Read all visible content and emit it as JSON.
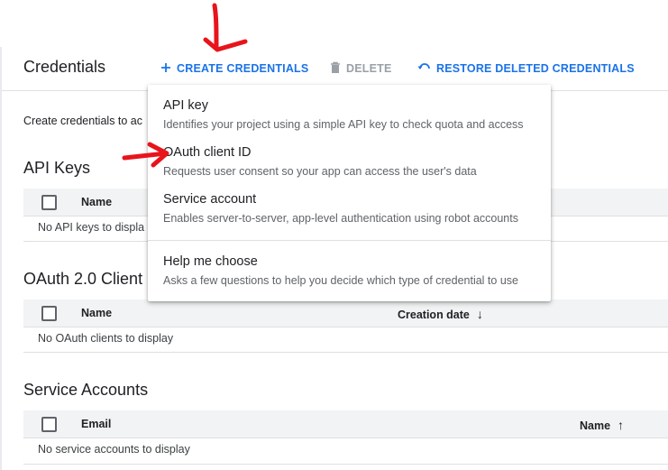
{
  "header": {
    "title": "Credentials",
    "create_label": "CREATE CREDENTIALS",
    "delete_label": "DELETE",
    "restore_label": "RESTORE DELETED CREDENTIALS"
  },
  "intro_text": "Create credentials to ac",
  "api_keys": {
    "title": "API Keys",
    "columns": [
      "Name"
    ],
    "empty": "No API keys to displa"
  },
  "oauth": {
    "title": "OAuth 2.0 Client I",
    "columns": [
      "Name",
      "Creation date"
    ],
    "empty": "No OAuth clients to display"
  },
  "service_accounts": {
    "title": "Service Accounts",
    "columns": [
      "Email",
      "Name"
    ],
    "empty": "No service accounts to display"
  },
  "menu": {
    "items": [
      {
        "title": "API key",
        "desc": "Identifies your project using a simple API key to check quota and access"
      },
      {
        "title": "OAuth client ID",
        "desc": "Requests user consent so your app can access the user's data"
      },
      {
        "title": "Service account",
        "desc": "Enables server-to-server, app-level authentication using robot accounts"
      },
      {
        "title": "Help me choose",
        "desc": "Asks a few questions to help you decide which type of credential to use"
      }
    ]
  },
  "colors": {
    "accent": "#1a73e8",
    "disabled": "#9aa0a6",
    "annotation": "#e8141c",
    "header_bg": "#f1f3f4"
  },
  "icons": [
    "plus-icon",
    "trash-icon",
    "restore-icon",
    "arrow-down-icon",
    "arrow-up-icon"
  ]
}
